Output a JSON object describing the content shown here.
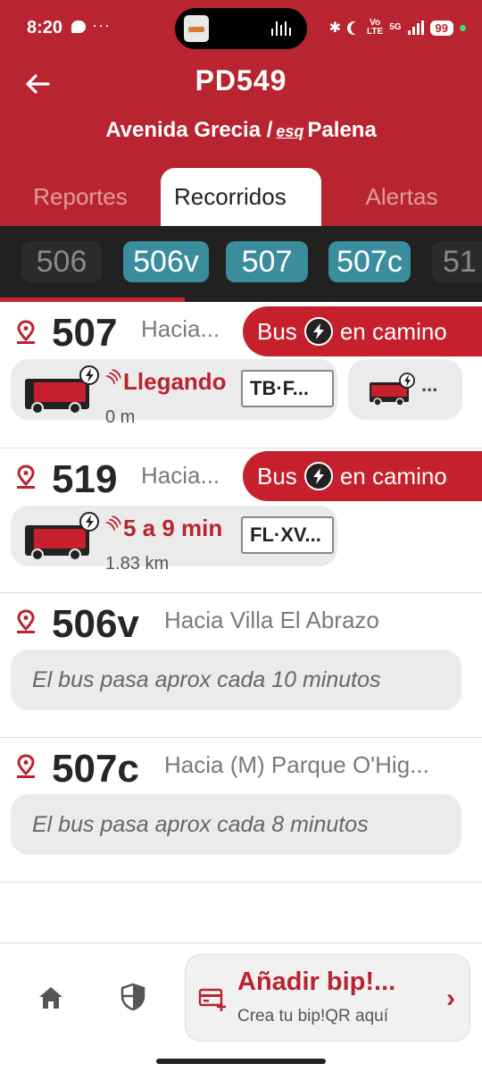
{
  "status": {
    "time": "8:20",
    "dots": "···",
    "volte": "Vo\nLTE",
    "network": "5G",
    "battery": "99"
  },
  "header": {
    "stop_code": "PD549",
    "stop_street": "Avenida Grecia /",
    "stop_esq": "esq",
    "stop_cross": "Palena"
  },
  "tabs": [
    {
      "label": "Reportes"
    },
    {
      "label": "Recorridos"
    },
    {
      "label": "Alertas"
    }
  ],
  "route_chips": [
    {
      "label": "506",
      "selected": false
    },
    {
      "label": "506v",
      "selected": true
    },
    {
      "label": "507",
      "selected": true
    },
    {
      "label": "507c",
      "selected": true
    },
    {
      "label": "51",
      "selected": false
    }
  ],
  "routes": [
    {
      "number": "507",
      "direction": "Hacia...",
      "badge": {
        "left": "Bus",
        "right": "en camino"
      },
      "bus": {
        "eta": "Llegando",
        "distance": "0 m",
        "plate": "TB·F...",
        "more": "..."
      }
    },
    {
      "number": "519",
      "direction": "Hacia...",
      "badge": {
        "left": "Bus",
        "right": "en camino"
      },
      "bus": {
        "eta": "5 a 9 min",
        "distance": "1.83 km",
        "plate": "FL·XV..."
      }
    },
    {
      "number": "506v",
      "direction": "Hacia Villa El Abrazo",
      "frequency": "El bus pasa aprox cada 10 minutos"
    },
    {
      "number": "507c",
      "direction": "Hacia (M) Parque O'Hig...",
      "frequency": "El bus pasa aprox cada 8 minutos"
    }
  ],
  "bottom": {
    "bip_title": "Añadir bip!...",
    "bip_subtitle": "Crea tu bip!QR aquí"
  },
  "colors": {
    "brand_red": "#b8242f",
    "chip_teal": "#3a8d9c",
    "chip_bar": "#212121"
  }
}
